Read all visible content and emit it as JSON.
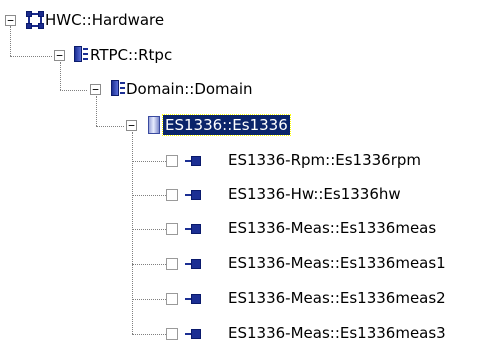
{
  "tree": {
    "root": {
      "label": "HWC::Hardware",
      "icon": "hardware-icon",
      "expander": "−"
    },
    "rtpc": {
      "label": "RTPC::Rtpc",
      "icon": "rtpc-module-icon",
      "expander": "−"
    },
    "domain": {
      "label": "Domain::Domain",
      "icon": "domain-module-icon",
      "expander": "−"
    },
    "device": {
      "label": "ES1336::Es1336",
      "icon": "device-icon",
      "expander": "−",
      "selected": true
    },
    "children": [
      {
        "label": "ES1336-Rpm::Es1336rpm",
        "icon": "signal-port-icon"
      },
      {
        "label": "ES1336-Hw::Es1336hw",
        "icon": "signal-port-icon"
      },
      {
        "label": "ES1336-Meas::Es1336meas",
        "icon": "signal-port-icon"
      },
      {
        "label": "ES1336-Meas::Es1336meas1",
        "icon": "signal-port-icon"
      },
      {
        "label": "ES1336-Meas::Es1336meas2",
        "icon": "signal-port-icon"
      },
      {
        "label": "ES1336-Meas::Es1336meas3",
        "icon": "signal-port-icon"
      }
    ]
  },
  "colors": {
    "selection_bg": "#0a246a",
    "icon_blue": "#1c2f93",
    "connector": "#808080"
  }
}
